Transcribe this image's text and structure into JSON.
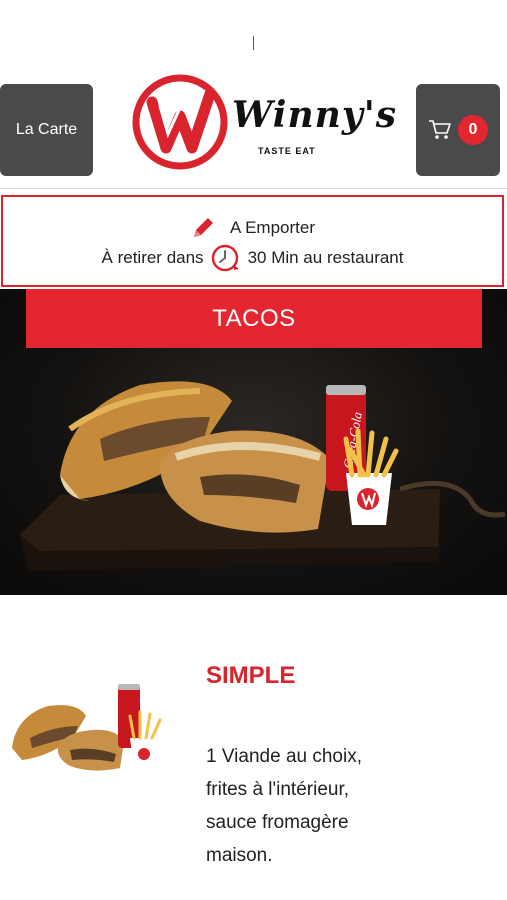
{
  "header": {
    "menu_label": "La Carte",
    "brand_name": "Winny's",
    "brand_tagline": "TASTE EAT",
    "cart_count": "0"
  },
  "order_info": {
    "mode_label": "A Emporter",
    "pickup_prefix": "À retirer dans",
    "pickup_suffix": "30 Min au restaurant"
  },
  "category": {
    "title": "TACOS",
    "can_brand": "Coca-Cola"
  },
  "product": {
    "name": "SIMPLE",
    "description": "1 Viande au choix,\nfrites à l'intérieur,\nsauce fromagère\nmaison."
  },
  "colors": {
    "accent": "#e3262f",
    "nav_button": "#4a4a4a"
  }
}
